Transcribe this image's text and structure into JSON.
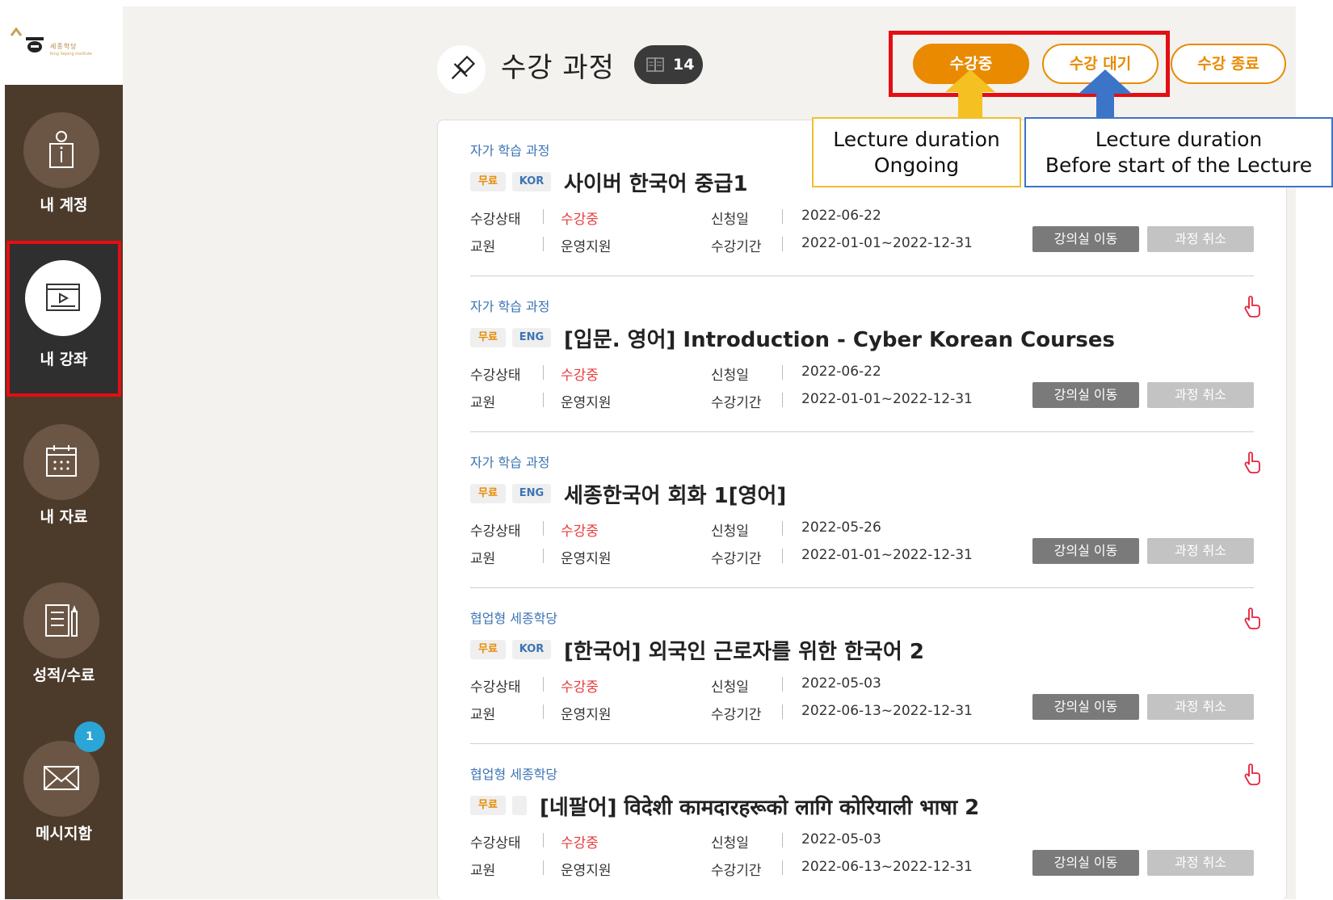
{
  "logo": {
    "name_ko": "세종학당",
    "name_en": "King Sejong Institute"
  },
  "nav": [
    {
      "label": "내 계정",
      "icon": "account-info-icon"
    },
    {
      "label": "내 강좌",
      "icon": "video-lecture-icon",
      "active": true
    },
    {
      "label": "내 자료",
      "icon": "calendar-icon"
    },
    {
      "label": "성적/수료",
      "icon": "report-icon"
    },
    {
      "label": "메시지함",
      "icon": "envelope-icon",
      "badge": "1"
    }
  ],
  "header": {
    "title": "수강 과정",
    "count": "14"
  },
  "tabs": {
    "ongoing": "수강중",
    "waiting": "수강 대기",
    "done": "수강 종료"
  },
  "callouts": {
    "ongoing_l1": "Lecture duration",
    "ongoing_l2": "Ongoing",
    "waiting_l1": "Lecture duration",
    "waiting_l2": "Before start of the Lecture"
  },
  "labels": {
    "status": "수강상태",
    "teacher": "교원",
    "apply_date": "신청일",
    "period": "수강기간",
    "go_classroom": "강의실 이동",
    "cancel_course": "과정 취소"
  },
  "courses": [
    {
      "type": "자가 학습 과정",
      "free": "무료",
      "lang": "KOR",
      "title": "사이버 한국어 중급1",
      "status": "수강중",
      "teacher": "운영지원",
      "apply_date": "2022-06-22",
      "period": "2022-01-01~2022-12-31"
    },
    {
      "type": "자가 학습 과정",
      "free": "무료",
      "lang": "ENG",
      "title": "[입문. 영어] Introduction - Cyber Korean Courses",
      "status": "수강중",
      "teacher": "운영지원",
      "apply_date": "2022-06-22",
      "period": "2022-01-01~2022-12-31"
    },
    {
      "type": "자가 학습 과정",
      "free": "무료",
      "lang": "ENG",
      "title": "세종한국어 회화 1[영어]",
      "status": "수강중",
      "teacher": "운영지원",
      "apply_date": "2022-05-26",
      "period": "2022-01-01~2022-12-31"
    },
    {
      "type": "협업형 세종학당",
      "free": "무료",
      "lang": "KOR",
      "title": "[한국어] 외국인 근로자를 위한 한국어 2",
      "status": "수강중",
      "teacher": "운영지원",
      "apply_date": "2022-05-03",
      "period": "2022-06-13~2022-12-31"
    },
    {
      "type": "협업형 세종학당",
      "free": "무료",
      "lang": "",
      "title": "[네팔어] विदेशी कामदारहरूको लागि कोरियाली भाषा 2",
      "status": "수강중",
      "teacher": "운영지원",
      "apply_date": "2022-05-03",
      "period": "2022-06-13~2022-12-31"
    }
  ],
  "colors": {
    "accent": "#e98a00",
    "sidebar": "#4c3b2b",
    "highlight": "#e40e13",
    "link": "#3c74b4"
  }
}
